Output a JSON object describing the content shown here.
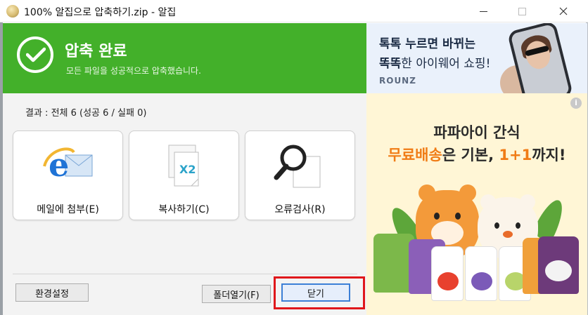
{
  "window": {
    "title": "100% 알집으로 압축하기.zip - 알집"
  },
  "header": {
    "title": "압축 완료",
    "subtitle": "모든 파일을 성공적으로 압축했습니다."
  },
  "result_text": "결과 : 전체 6 (성공 6 / 실패 0)",
  "actions": {
    "email": "메일에 첨부(E)",
    "copy": "복사하기(C)",
    "scan": "오류검사(R)",
    "copy_icon_text": "X2"
  },
  "footer": {
    "settings": "환경설정",
    "open_folder": "폴더열기(F)",
    "close": "닫기"
  },
  "ads": {
    "top_line1": "톡톡 누르면 바뀌는",
    "top_line2_bold": "똑똑",
    "top_line2_rest": "한 아이웨어 쇼핑!",
    "top_brand": "ROUNZ",
    "main_line1": "파파아이 간식",
    "main_line2_orange": "무료배송",
    "main_line2_mid": "은 기본, ",
    "main_line2_bold_orange": "1+1",
    "main_line2_end": "까지!",
    "info": "i"
  },
  "colors": {
    "header_green": "#43b02a",
    "highlight_red": "#e0171b",
    "focus_blue": "#3c7fd6",
    "ad_orange": "#f07c16"
  }
}
